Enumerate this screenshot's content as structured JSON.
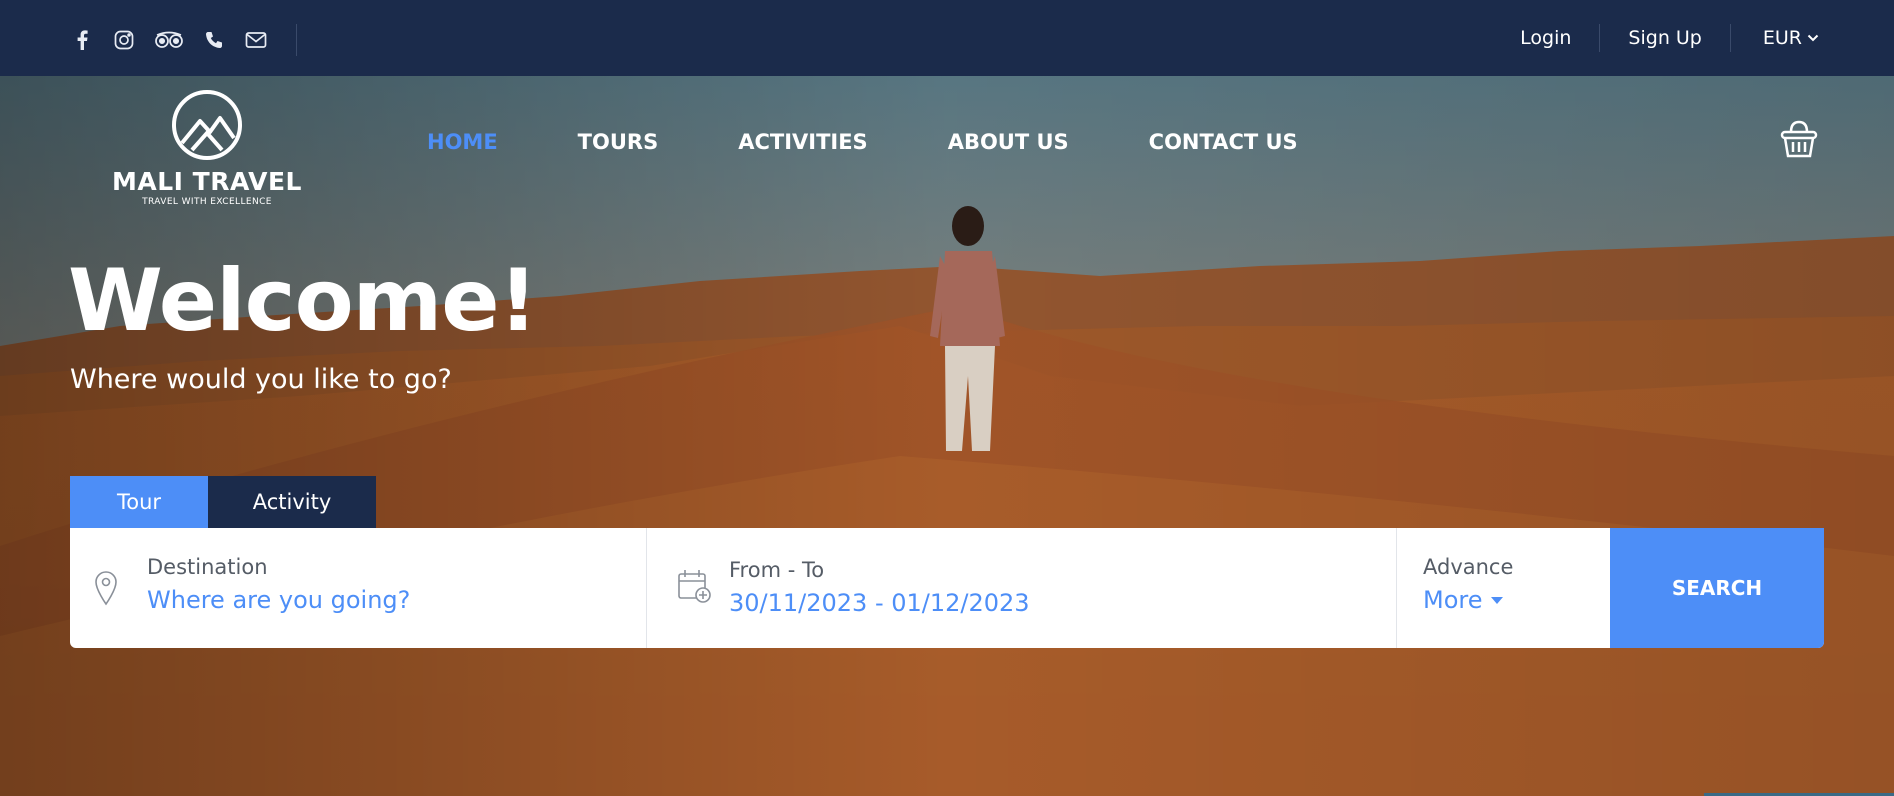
{
  "topbar": {
    "social": [
      {
        "name": "facebook-icon"
      },
      {
        "name": "instagram-icon"
      },
      {
        "name": "tripadvisor-icon"
      },
      {
        "name": "phone-icon"
      },
      {
        "name": "mail-icon"
      }
    ],
    "login": "Login",
    "signup": "Sign Up",
    "currency": "EUR"
  },
  "logo": {
    "name": "MALI TRAVEL",
    "tagline": "TRAVEL WITH EXCELLENCE"
  },
  "nav": {
    "items": [
      "HOME",
      "TOURS",
      "ACTIVITIES",
      "ABOUT US",
      "CONTACT US"
    ],
    "active": "HOME"
  },
  "hero": {
    "title": "Welcome!",
    "subtitle": "Where would you like to go?"
  },
  "tabs": {
    "tour": "Tour",
    "activity": "Activity",
    "active": "Tour"
  },
  "search": {
    "destination_label": "Destination",
    "destination_placeholder": "Where are you going?",
    "date_label": "From - To",
    "date_value": "30/11/2023 - 01/12/2023",
    "advance_label": "Advance",
    "more_label": "More",
    "button": "SEARCH"
  },
  "colors": {
    "topbar": "#1b2b4b",
    "accent": "#4d8ef7"
  }
}
